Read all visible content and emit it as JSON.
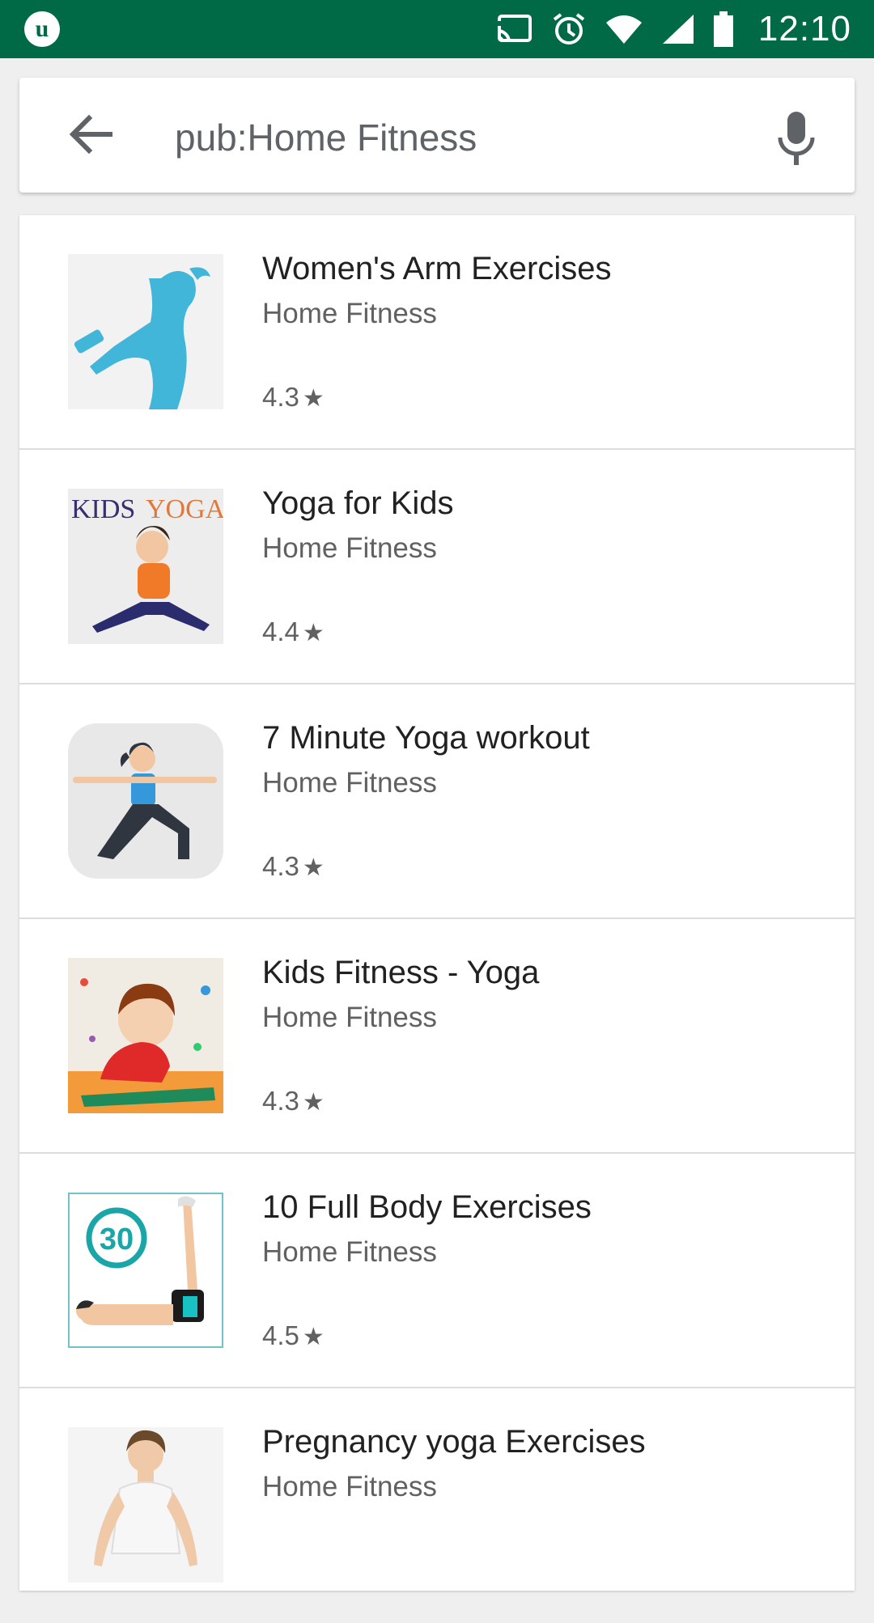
{
  "status_bar": {
    "time": "12:10",
    "icons": [
      "cast-icon",
      "alarm-icon",
      "wifi-icon",
      "signal-icon",
      "battery-icon"
    ]
  },
  "search": {
    "query": "pub:Home Fitness"
  },
  "results": [
    {
      "title": "Women's Arm Exercises",
      "publisher": "Home Fitness",
      "rating": "4.3"
    },
    {
      "title": "Yoga for Kids",
      "publisher": "Home Fitness",
      "rating": "4.4",
      "icon_text_1": "KIDS",
      "icon_text_2": "YOGA"
    },
    {
      "title": "7 Minute Yoga workout",
      "publisher": "Home Fitness",
      "rating": "4.3"
    },
    {
      "title": "Kids Fitness - Yoga",
      "publisher": "Home Fitness",
      "rating": "4.3"
    },
    {
      "title": "10 Full Body Exercises",
      "publisher": "Home Fitness",
      "rating": "4.5",
      "icon_badge": "30"
    },
    {
      "title": "Pregnancy yoga Exercises",
      "publisher": "Home Fitness",
      "rating": ""
    }
  ],
  "colors": {
    "status_bar": "#006a46",
    "accent_blue": "#41b6d8"
  }
}
